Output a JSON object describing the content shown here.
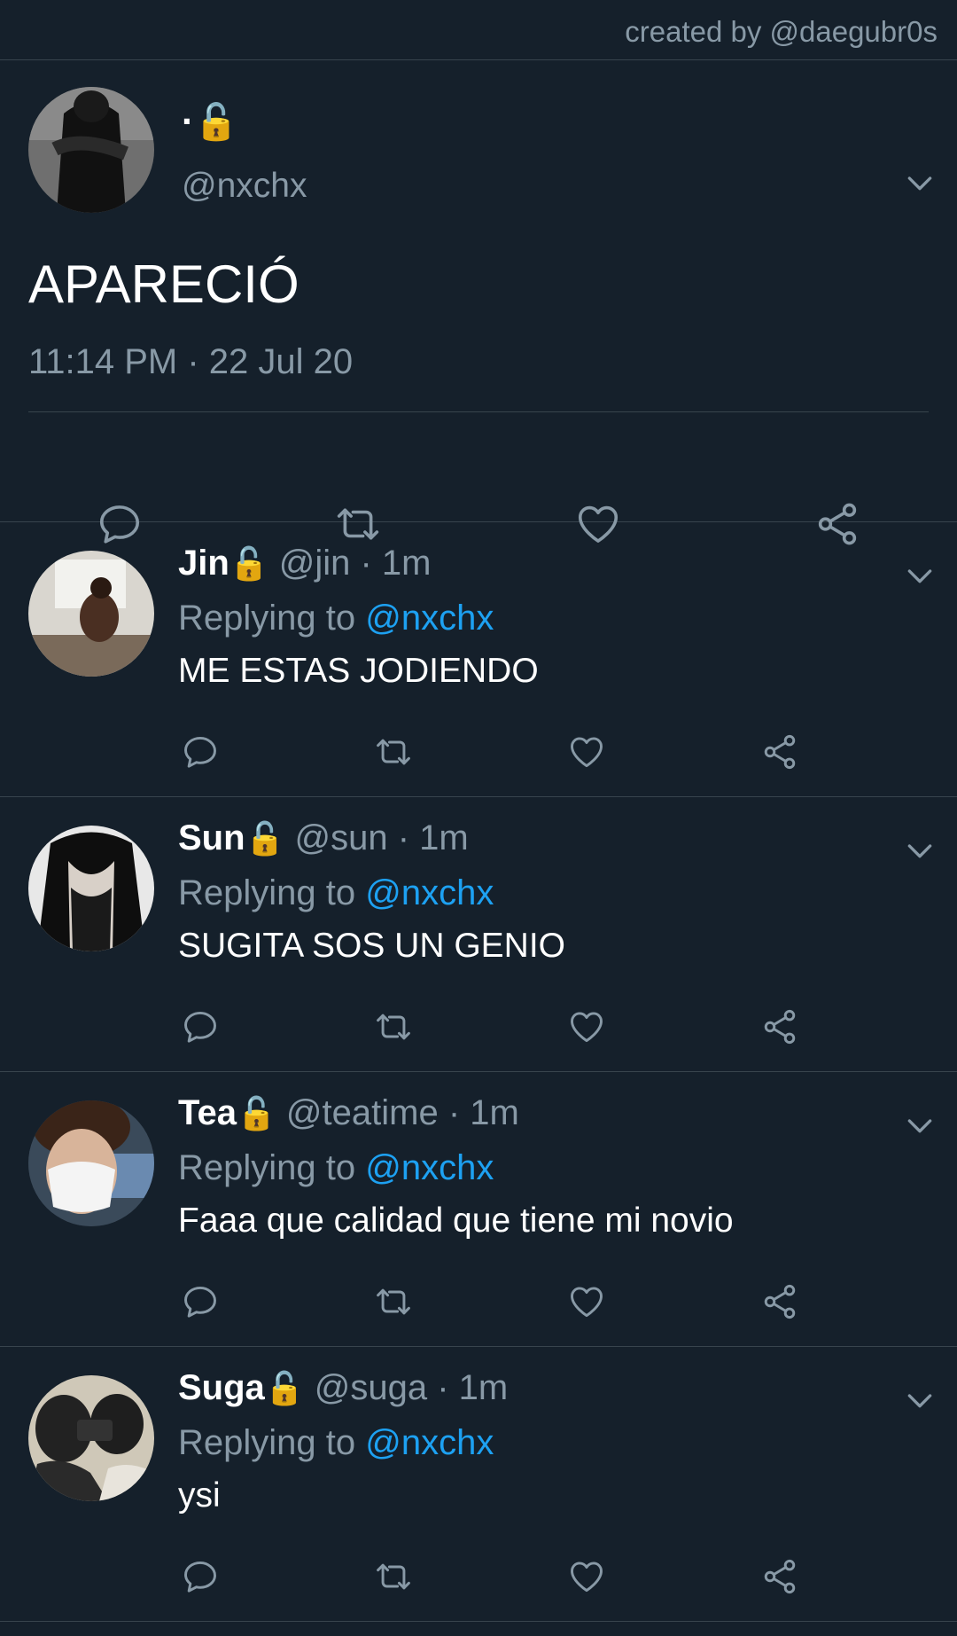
{
  "credit": "created by @daegubr0s",
  "main_tweet": {
    "name": "·",
    "lock": "🔓",
    "handle": "@nxchx",
    "text": "APARECIÓ",
    "timestamp": "11:14 PM · 22 Jul 20"
  },
  "replies": [
    {
      "name": "Jin",
      "lock": "🔓",
      "handle": "@jin",
      "sep": " · ",
      "time": "1m",
      "replying_label": "Replying to ",
      "mention": "@nxchx",
      "text": "ME ESTAS JODIENDO"
    },
    {
      "name": "Sun",
      "lock": "🔓",
      "handle": "@sun",
      "sep": " · ",
      "time": "1m",
      "replying_label": "Replying to ",
      "mention": "@nxchx",
      "text": "SUGITA SOS UN GENIO"
    },
    {
      "name": "Tea",
      "lock": "🔓",
      "handle": "@teatime",
      "sep": " · ",
      "time": "1m",
      "replying_label": "Replying to ",
      "mention": "@nxchx",
      "text": "Faaa que calidad que tiene mi novio"
    },
    {
      "name": "Suga",
      "lock": "🔓",
      "handle": "@suga",
      "sep": " · ",
      "time": "1m",
      "replying_label": "Replying to ",
      "mention": "@nxchx",
      "text": "ysi"
    }
  ],
  "icons": {
    "reply": "reply-icon",
    "retweet": "retweet-icon",
    "like": "heart-icon",
    "share": "share-icon",
    "menu": "chevron-down-icon"
  },
  "colors": {
    "background": "#15202b",
    "muted": "#8899a6",
    "accent": "#1da1f2",
    "divider": "#38444d"
  }
}
